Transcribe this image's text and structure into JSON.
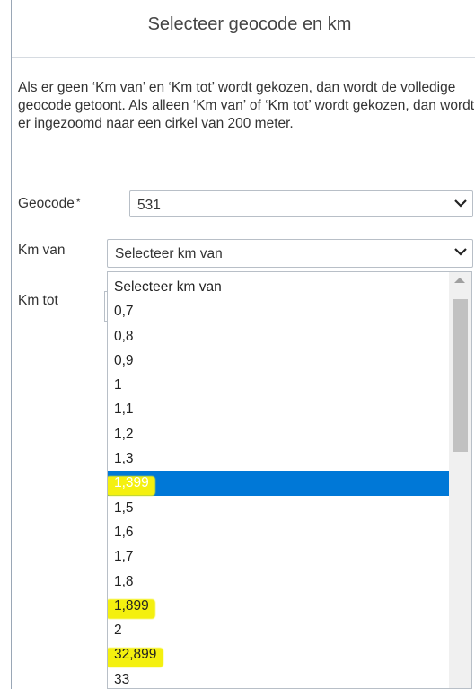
{
  "dialog": {
    "title": "Selecteer geocode en km",
    "close_glyph": "×",
    "description": "Als er geen ‘Km van’ en ‘Km tot’ wordt gekozen, dan wordt de volledige geocode getoont. Als alleen ‘Km van’ of ‘Km tot’ wordt gekozen, dan wordt er ingezoomd naar een cirkel van 200 meter."
  },
  "form": {
    "geocode_label": "Geocode",
    "required_mark": "*",
    "geocode_value": "531",
    "km_van_label": "Km van",
    "km_van_value": "Selecteer km van",
    "km_tot_label": "Km tot"
  },
  "dropdown": {
    "options": [
      "Selecteer km van",
      "0,7",
      "0,8",
      "0,9",
      "1",
      "1,1",
      "1,2",
      "1,3",
      "1,399",
      "1,5",
      "1,6",
      "1,7",
      "1,8",
      "1,899",
      "2",
      "32,899",
      "33"
    ],
    "selected_index": 8,
    "highlighted_indices": [
      8,
      13,
      15
    ],
    "highlight_color": "#f4f00f",
    "selected_color": "#0078d7"
  }
}
